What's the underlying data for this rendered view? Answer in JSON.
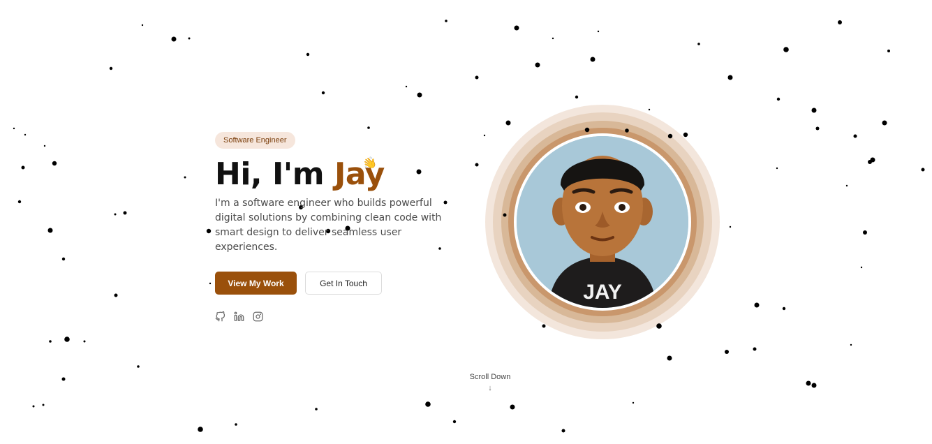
{
  "hero": {
    "badge": "Software Engineer",
    "greeting": "Hi, I'm ",
    "name": "Jay",
    "wave_emoji": "👋",
    "description": "I'm a software engineer who builds powerful digital solutions by combining clean code with smart design to deliver seamless user experiences.",
    "primary_button": "View My Work",
    "secondary_button": "Get In Touch",
    "socials": [
      "github-icon",
      "linkedin-icon",
      "instagram-icon"
    ]
  },
  "avatar": {
    "shirt_text": "JAY"
  },
  "scroll": {
    "label": "Scroll Down",
    "arrow": "↓"
  },
  "colors": {
    "accent": "#9a500b",
    "badge_bg": "#f6e6dc",
    "badge_text": "#7a3d0a",
    "avatar_bg": "#a8c8d8"
  }
}
